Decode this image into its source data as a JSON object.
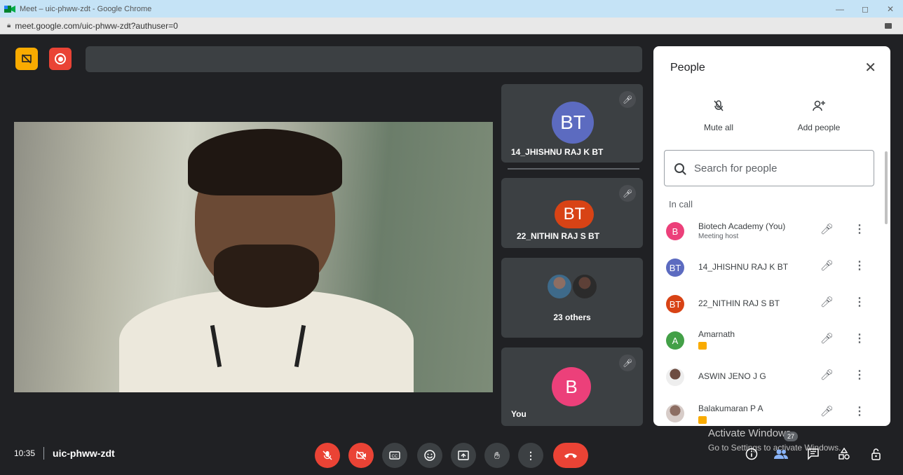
{
  "browser": {
    "title": "Meet – uic-phww-zdt - Google Chrome",
    "url": "meet.google.com/uic-phww-zdt?authuser=0",
    "minimize": "—",
    "restore": "◻",
    "close": "✕"
  },
  "tiles": [
    {
      "initials": "BT",
      "name": "14_JHISHNU RAJ K BT",
      "color": "#5c6bc0"
    },
    {
      "initials": "BT",
      "name": "22_NITHIN RAJ S BT",
      "color": "#d84315"
    },
    {
      "name": "23 others"
    },
    {
      "initials": "B",
      "name": "You",
      "color": "#ec407a"
    }
  ],
  "people_panel": {
    "title": "People",
    "close": "✕",
    "mute_all": "Mute all",
    "add_people": "Add people",
    "search_placeholder": "Search for people",
    "in_call_label": "In call",
    "participants": [
      {
        "initials": "B",
        "name": "Biotech Academy (You)",
        "sub": "Meeting host",
        "color": "#ec407a"
      },
      {
        "initials": "BT",
        "name": "14_JHISHNU RAJ K BT",
        "color": "#5c6bc0"
      },
      {
        "initials": "BT",
        "name": "22_NITHIN RAJ S BT",
        "color": "#d84315"
      },
      {
        "initials": "A",
        "name": "Amarnath",
        "color": "#43a047"
      },
      {
        "name": "ASWIN JENO J G"
      },
      {
        "name": "Balakumaran P A"
      }
    ]
  },
  "bottom": {
    "time": "10:35",
    "meeting_code": "uic-phww-zdt",
    "participant_count": "27",
    "activate_title": "Activate Windows",
    "activate_sub": "Go to Settings to activate Windows."
  }
}
